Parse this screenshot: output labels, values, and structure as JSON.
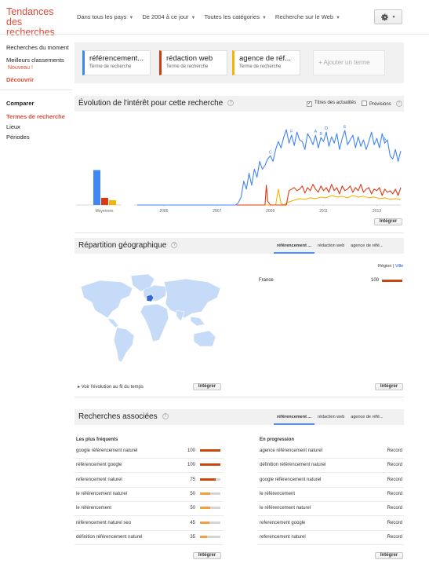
{
  "header": {
    "app_title": "Tendances des recherches",
    "filters": [
      {
        "label": "Dans tous les pays"
      },
      {
        "label": "De 2004 à ce jour"
      },
      {
        "label": "Toutes les catégories"
      },
      {
        "label": "Recherche sur le Web"
      }
    ],
    "settings_icon": "gear-icon"
  },
  "sidebar": {
    "items": [
      {
        "label": "Recherches du moment"
      },
      {
        "label": "Meilleurs classements",
        "badge": "Nouveau !"
      },
      {
        "label": "Découvrir"
      }
    ],
    "compare_heading": "Comparer",
    "compare_items": [
      {
        "label": "Termes de recherche",
        "active": true
      },
      {
        "label": "Lieux"
      },
      {
        "label": "Périodes"
      }
    ]
  },
  "terms": [
    {
      "name": "référencement...",
      "sub": "Terme de recherche",
      "color": "#4285f4"
    },
    {
      "name": "rédaction web",
      "sub": "Terme de recherche",
      "color": "#dc3912"
    },
    {
      "name": "agence de réf...",
      "sub": "Terme de recherche",
      "color": "#f4b400"
    }
  ],
  "add_term_label": "+ Ajouter un terme",
  "interest": {
    "title": "Évolution de l'intérêt pour cette recherche",
    "news_headlines_label": "Titres des actualités",
    "news_headlines_checked": true,
    "forecast_label": "Prévisions",
    "forecast_checked": false,
    "embed_label": "Intégrer"
  },
  "geo": {
    "title": "Répartition géographique",
    "tabs": [
      "référencement ...",
      "rédaction web",
      "agence de réfé..."
    ],
    "active_tab": 0,
    "region_label": "Région",
    "city_label": "Ville",
    "rows": [
      {
        "country": "France",
        "value": 100
      }
    ],
    "highlight_country": "France",
    "evolution_link": "Voir l'évolution au fil du temps",
    "embed_map_label": "Intégrer",
    "embed_list_label": "Intégrer"
  },
  "related": {
    "title": "Recherches associées",
    "tabs": [
      "référencement ...",
      "rédaction web",
      "agence de réfé..."
    ],
    "active_tab": 0,
    "top_heading": "Les plus fréquents",
    "rising_heading": "En progression",
    "top": [
      {
        "query": "google référencement naturel",
        "value": 100
      },
      {
        "query": "référencement google",
        "value": 100
      },
      {
        "query": "referencement naturel",
        "value": 75
      },
      {
        "query": "le référencement naturel",
        "value": 50
      },
      {
        "query": "le référencement",
        "value": 50
      },
      {
        "query": "référencement naturel seo",
        "value": 45
      },
      {
        "query": "définition référencement naturel",
        "value": 35
      }
    ],
    "rising": [
      {
        "query": "agence référencement naturel",
        "value": "Record"
      },
      {
        "query": "définition référencement naturel",
        "value": "Record"
      },
      {
        "query": "google référencement naturel",
        "value": "Record"
      },
      {
        "query": "le référencement",
        "value": "Record"
      },
      {
        "query": "le référencement naturel",
        "value": "Record"
      },
      {
        "query": "referencement google",
        "value": "Record"
      },
      {
        "query": "referencement naturel",
        "value": "Record"
      }
    ],
    "embed_top_label": "Intégrer",
    "embed_rising_label": "Intégrer"
  },
  "chart_data": {
    "type": "line",
    "averages_label": "Moyennes",
    "averages": [
      {
        "series": "référencement...",
        "value": 44
      },
      {
        "series": "rédaction web",
        "value": 9
      },
      {
        "series": "agence de réf...",
        "value": 6
      }
    ],
    "x_tick_labels": [
      "2005",
      "2007",
      "2009",
      "2011",
      "2013"
    ],
    "x_range": [
      2004.0,
      2013.9
    ],
    "y_range": [
      0,
      100
    ],
    "annotation_markers": [
      {
        "letter": "F",
        "x": 2009.8
      },
      {
        "letter": "C",
        "x": 2009.0
      },
      {
        "letter": "A",
        "x": 2010.7
      },
      {
        "letter": "B",
        "x": 2010.9
      },
      {
        "letter": "D",
        "x": 2011.1
      },
      {
        "letter": "E",
        "x": 2011.8
      },
      {
        "letter": "A",
        "x": 2013.3
      }
    ],
    "series": [
      {
        "name": "référencement...",
        "color": "#4285f4",
        "points": [
          [
            2004.0,
            0
          ],
          [
            2007.7,
            0
          ],
          [
            2007.8,
            3
          ],
          [
            2007.9,
            10
          ],
          [
            2008.0,
            30
          ],
          [
            2008.1,
            20
          ],
          [
            2008.2,
            40
          ],
          [
            2008.3,
            25
          ],
          [
            2008.4,
            45
          ],
          [
            2008.5,
            35
          ],
          [
            2008.6,
            55
          ],
          [
            2008.7,
            45
          ],
          [
            2008.8,
            50
          ],
          [
            2008.9,
            58
          ],
          [
            2009.0,
            62
          ],
          [
            2009.1,
            55
          ],
          [
            2009.2,
            70
          ],
          [
            2009.3,
            80
          ],
          [
            2009.4,
            72
          ],
          [
            2009.5,
            85
          ],
          [
            2009.6,
            95
          ],
          [
            2009.7,
            78
          ],
          [
            2009.8,
            88
          ],
          [
            2009.9,
            75
          ],
          [
            2010.0,
            92
          ],
          [
            2010.1,
            82
          ],
          [
            2010.2,
            80
          ],
          [
            2010.3,
            70
          ],
          [
            2010.4,
            90
          ],
          [
            2010.5,
            84
          ],
          [
            2010.6,
            76
          ],
          [
            2010.7,
            88
          ],
          [
            2010.8,
            72
          ],
          [
            2010.9,
            85
          ],
          [
            2011.0,
            80
          ],
          [
            2011.1,
            92
          ],
          [
            2011.2,
            74
          ],
          [
            2011.3,
            86
          ],
          [
            2011.4,
            78
          ],
          [
            2011.5,
            90
          ],
          [
            2011.6,
            70
          ],
          [
            2011.7,
            84
          ],
          [
            2011.8,
            94
          ],
          [
            2011.9,
            76
          ],
          [
            2012.0,
            82
          ],
          [
            2012.1,
            88
          ],
          [
            2012.2,
            72
          ],
          [
            2012.3,
            86
          ],
          [
            2012.4,
            74
          ],
          [
            2012.5,
            82
          ],
          [
            2012.6,
            70
          ],
          [
            2012.7,
            80
          ],
          [
            2012.8,
            92
          ],
          [
            2012.9,
            76
          ],
          [
            2013.0,
            84
          ],
          [
            2013.1,
            72
          ],
          [
            2013.2,
            90
          ],
          [
            2013.3,
            78
          ],
          [
            2013.4,
            82
          ],
          [
            2013.5,
            62
          ],
          [
            2013.6,
            58
          ],
          [
            2013.7,
            70
          ],
          [
            2013.8,
            55
          ],
          [
            2013.9,
            68
          ]
        ]
      },
      {
        "name": "rédaction web",
        "color": "#dc3912",
        "points": [
          [
            2004.0,
            0
          ],
          [
            2008.8,
            0
          ],
          [
            2008.85,
            25
          ],
          [
            2008.9,
            5
          ],
          [
            2009.0,
            0
          ],
          [
            2009.2,
            0
          ],
          [
            2009.6,
            0
          ],
          [
            2009.7,
            18
          ],
          [
            2009.8,
            20
          ],
          [
            2009.9,
            22
          ],
          [
            2010.0,
            18
          ],
          [
            2010.1,
            20
          ],
          [
            2010.2,
            24
          ],
          [
            2010.3,
            15
          ],
          [
            2010.4,
            22
          ],
          [
            2010.5,
            18
          ],
          [
            2010.6,
            26
          ],
          [
            2010.7,
            20
          ],
          [
            2010.8,
            16
          ],
          [
            2010.9,
            24
          ],
          [
            2011.0,
            18
          ],
          [
            2011.1,
            22
          ],
          [
            2011.2,
            16
          ],
          [
            2011.3,
            26
          ],
          [
            2011.4,
            18
          ],
          [
            2011.5,
            22
          ],
          [
            2011.6,
            14
          ],
          [
            2011.7,
            24
          ],
          [
            2011.8,
            18
          ],
          [
            2011.9,
            20
          ],
          [
            2012.0,
            24
          ],
          [
            2012.1,
            16
          ],
          [
            2012.2,
            22
          ],
          [
            2012.3,
            18
          ],
          [
            2012.4,
            26
          ],
          [
            2012.5,
            16
          ],
          [
            2012.6,
            20
          ],
          [
            2012.7,
            22
          ],
          [
            2012.8,
            14
          ],
          [
            2012.9,
            20
          ],
          [
            2013.0,
            18
          ],
          [
            2013.1,
            22
          ],
          [
            2013.2,
            12
          ],
          [
            2013.3,
            20
          ],
          [
            2013.4,
            16
          ],
          [
            2013.5,
            18
          ],
          [
            2013.6,
            14
          ],
          [
            2013.7,
            20
          ],
          [
            2013.8,
            12
          ],
          [
            2013.9,
            22
          ]
        ]
      },
      {
        "name": "agence de réf...",
        "color": "#f4b400",
        "points": [
          [
            2004.0,
            0
          ],
          [
            2009.2,
            0
          ],
          [
            2009.3,
            20
          ],
          [
            2009.4,
            2
          ],
          [
            2009.5,
            0
          ],
          [
            2009.7,
            4
          ],
          [
            2009.9,
            6
          ],
          [
            2010.1,
            8
          ],
          [
            2010.3,
            7
          ],
          [
            2010.5,
            9
          ],
          [
            2010.7,
            8
          ],
          [
            2010.9,
            10
          ],
          [
            2011.1,
            9
          ],
          [
            2011.3,
            12
          ],
          [
            2011.5,
            10
          ],
          [
            2011.7,
            11
          ],
          [
            2011.9,
            9
          ],
          [
            2012.1,
            12
          ],
          [
            2012.3,
            10
          ],
          [
            2012.5,
            11
          ],
          [
            2012.7,
            9
          ],
          [
            2012.9,
            10
          ],
          [
            2013.1,
            8
          ],
          [
            2013.3,
            9
          ],
          [
            2013.5,
            7
          ],
          [
            2013.7,
            8
          ],
          [
            2013.9,
            7
          ]
        ]
      }
    ]
  }
}
